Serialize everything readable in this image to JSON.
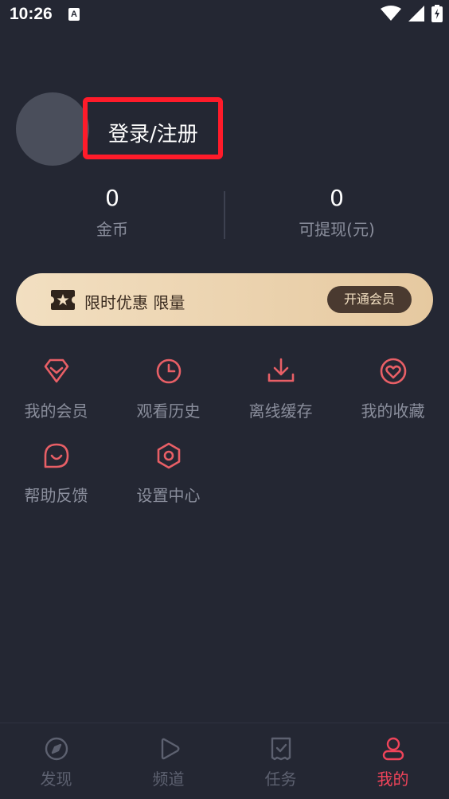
{
  "status": {
    "time": "10:26",
    "notification_badge": "A"
  },
  "profile": {
    "login_label": "登录/注册"
  },
  "stats": [
    {
      "value": "0",
      "label": "金币"
    },
    {
      "value": "0",
      "label": "可提现(元)"
    }
  ],
  "vip": {
    "text": "限时优惠 限量",
    "button": "开通会员",
    "icon": "ticket-star-icon"
  },
  "menu": [
    {
      "label": "我的会员",
      "icon": "diamond-icon"
    },
    {
      "label": "观看历史",
      "icon": "clock-icon"
    },
    {
      "label": "离线缓存",
      "icon": "download-icon"
    },
    {
      "label": "我的收藏",
      "icon": "heart-icon"
    },
    {
      "label": "帮助反馈",
      "icon": "chat-smile-icon"
    },
    {
      "label": "设置中心",
      "icon": "settings-hex-icon"
    }
  ],
  "nav": [
    {
      "label": "发现",
      "icon": "compass-icon"
    },
    {
      "label": "频道",
      "icon": "play-icon"
    },
    {
      "label": "任务",
      "icon": "task-icon"
    },
    {
      "label": "我的",
      "icon": "user-icon",
      "active": true
    }
  ],
  "colors": {
    "background": "#242733",
    "accent": "#f0445a",
    "icon_accent": "#e85f66",
    "muted_text": "#8a8e9c",
    "highlight_border": "#ff1b2a"
  }
}
